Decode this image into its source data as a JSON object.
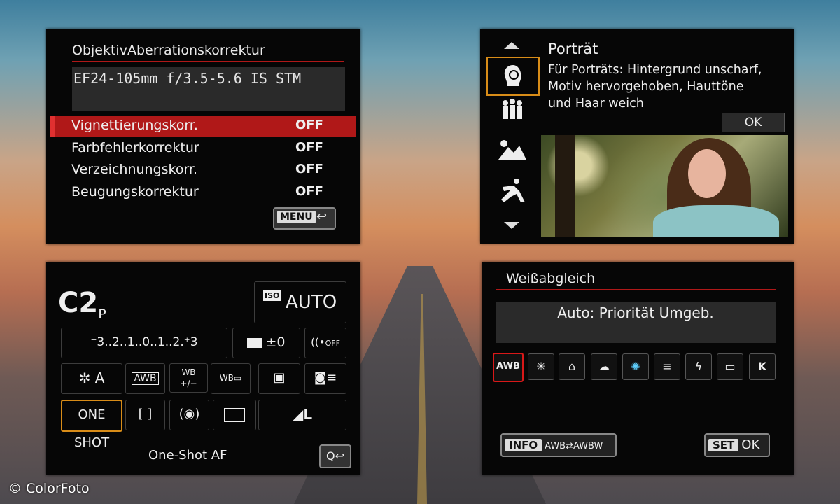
{
  "panel_lens": {
    "title": "ObjektivAberrationskorrektur",
    "lens_name": "EF24-105mm f/3.5-5.6 IS STM",
    "rows": [
      {
        "label": "Vignettierungskorr.",
        "value": "OFF"
      },
      {
        "label": "Farbfehlerkorrektur",
        "value": "OFF"
      },
      {
        "label": "Verzeichnungskorr.",
        "value": "OFF"
      },
      {
        "label": "Beugungskorrektur",
        "value": "OFF"
      }
    ],
    "menu_button": "MENU",
    "back_symbol": "↩"
  },
  "panel_scene": {
    "title": "Porträt",
    "description": "Für Porträts: Hintergrund unscharf, Motiv hervorgehoben, Hauttöne und Haar weich",
    "ok_label": "OK",
    "icons": [
      "portrait-icon",
      "group-icon",
      "landscape-icon",
      "sports-icon"
    ]
  },
  "panel_quick": {
    "mode": "C2",
    "mode_sub": "P",
    "iso_label": "ISO",
    "iso_value": "AUTO",
    "exposure_scale": "⁻3..2..1..0..1..2.⁺3",
    "flash_comp": "±0",
    "wifi": "OFF",
    "picture_style": "A",
    "wb": "AWB",
    "wb_shift": "+/−",
    "af_mode": "ONE SHOT",
    "quality": "L",
    "caption": "One-Shot AF",
    "q_button": "Q"
  },
  "panel_wb": {
    "title": "Weißabgleich",
    "current": "Auto: Priorität Umgeb.",
    "options": [
      "AWB",
      "☀",
      "⌂",
      "☁",
      "✺",
      "≡",
      "ϟ",
      "▭",
      "K"
    ],
    "info_label": "INFO",
    "info_text": "AWB⇄AWBW",
    "set_label": "SET",
    "ok_label": "OK"
  },
  "copyright": "© ColorFoto"
}
